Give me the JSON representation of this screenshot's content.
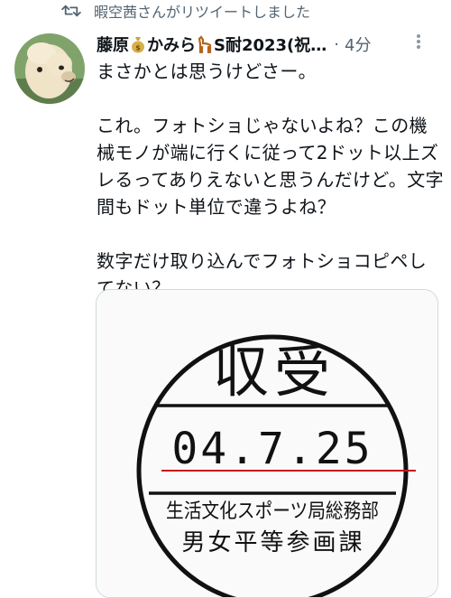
{
  "retweet": {
    "icon": "retweet-icon",
    "text": "暇空茜さんがリツイートしました"
  },
  "tweet": {
    "author_name": "藤原",
    "author_name_part2": "かみら",
    "author_name_part3": "S耐2023(祝…",
    "separator": "·",
    "time": "4分",
    "text": "まさかとは思うけどさー。\n\nこれ。フォトショじゃないよね？この機械モノが端に行くに従って2ドット以上ズレるってありえないと思うんだけど。文字間もドット単位で違うよね？\n\n数字だけ取り込んでフォトショコピペしてない？",
    "more_icon": "more-icon"
  },
  "stamp": {
    "top_text": "収受",
    "date": "04.7.25",
    "line1": "生活文化スポーツ局総務部",
    "line2": "男女平等参画課",
    "underline_color": "#c8141e"
  }
}
